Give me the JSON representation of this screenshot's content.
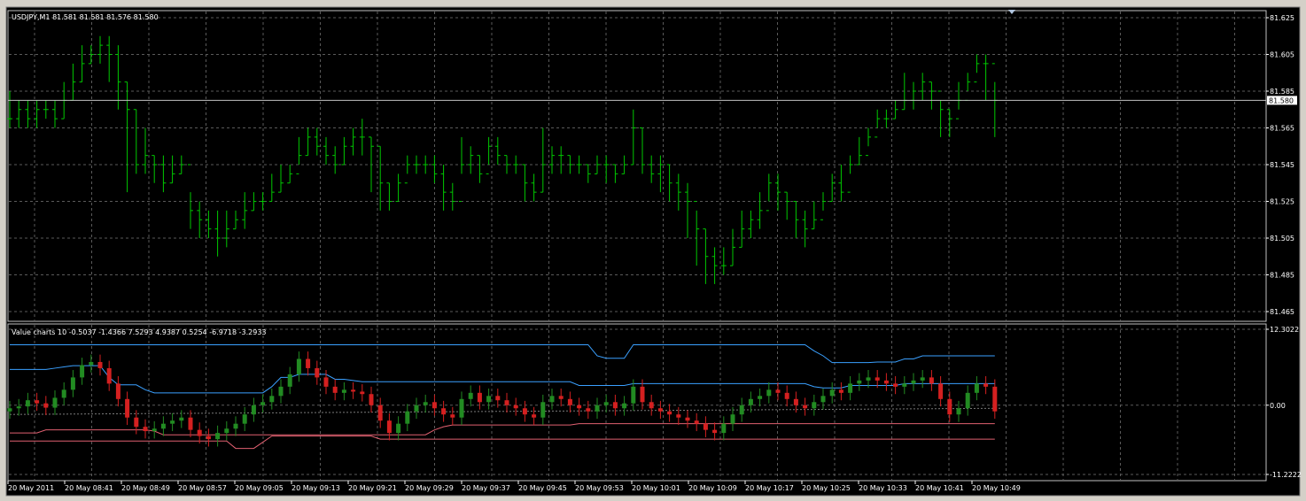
{
  "window": {
    "symbol_header": "USDJPY,M1  81.581 81.581 81.576 81.580"
  },
  "colors": {
    "background": "#000000",
    "grid": "#5a5a5a",
    "price_bars": "#00c800",
    "bull_candle": "#228b22",
    "bear_candle": "#d42020",
    "upper_band": "#3aa0ff",
    "lower_band": "#e06070",
    "axis_text": "#ffffff"
  },
  "chart_data": [
    {
      "type": "bar",
      "name": "price",
      "ohlc_style": "ohlc-bars",
      "ylim": [
        81.465,
        81.625
      ],
      "yticks": [
        "81.625",
        "81.605",
        "81.585",
        "81.565",
        "81.545",
        "81.525",
        "81.505",
        "81.485",
        "81.465"
      ],
      "current_price_label": "81.580",
      "current_price": 81.58,
      "grid": true,
      "close": [
        81.57,
        81.575,
        81.57,
        81.575,
        81.575,
        81.57,
        81.58,
        81.59,
        81.6,
        81.605,
        81.61,
        81.605,
        81.59,
        81.575,
        81.545,
        81.55,
        81.545,
        81.535,
        81.54,
        81.545,
        81.52,
        81.515,
        81.51,
        81.505,
        81.51,
        81.515,
        81.52,
        81.525,
        81.525,
        81.53,
        81.535,
        81.54,
        81.55,
        81.56,
        81.555,
        81.55,
        81.545,
        81.555,
        81.56,
        81.56,
        81.555,
        81.535,
        81.525,
        81.535,
        81.545,
        81.545,
        81.545,
        81.54,
        81.53,
        81.525,
        81.545,
        81.55,
        81.54,
        81.555,
        81.55,
        81.545,
        81.545,
        81.535,
        81.53,
        81.545,
        81.55,
        81.55,
        81.545,
        81.545,
        81.54,
        81.545,
        81.545,
        81.54,
        81.545,
        81.565,
        81.545,
        81.54,
        81.545,
        81.535,
        81.53,
        81.525,
        81.51,
        81.495,
        81.49,
        81.49,
        81.5,
        81.51,
        81.515,
        81.52,
        81.535,
        81.53,
        81.525,
        81.515,
        81.51,
        81.515,
        81.525,
        81.535,
        81.53,
        81.545,
        81.55,
        81.56,
        81.57,
        81.57,
        81.575,
        81.58,
        81.585,
        81.59,
        81.585,
        81.575,
        81.57,
        81.58,
        81.59,
        81.6,
        81.6,
        81.58
      ],
      "high": [
        81.585,
        81.58,
        81.58,
        81.58,
        81.58,
        81.58,
        81.59,
        81.6,
        81.61,
        81.61,
        81.615,
        81.615,
        81.61,
        81.59,
        81.575,
        81.565,
        81.55,
        81.55,
        81.55,
        81.55,
        81.53,
        81.525,
        81.52,
        81.52,
        81.52,
        81.52,
        81.53,
        81.53,
        81.53,
        81.54,
        81.545,
        81.545,
        81.56,
        81.565,
        81.565,
        81.56,
        81.555,
        81.56,
        81.565,
        81.57,
        81.56,
        81.555,
        81.535,
        81.54,
        81.55,
        81.55,
        81.55,
        81.55,
        81.545,
        81.535,
        81.56,
        81.555,
        81.55,
        81.56,
        81.56,
        81.55,
        81.55,
        81.545,
        81.54,
        81.565,
        81.555,
        81.555,
        81.55,
        81.55,
        81.545,
        81.55,
        81.55,
        81.545,
        81.55,
        81.575,
        81.565,
        81.55,
        81.55,
        81.545,
        81.54,
        81.535,
        81.52,
        81.51,
        81.5,
        81.5,
        81.51,
        81.52,
        81.52,
        81.53,
        81.54,
        81.54,
        81.53,
        81.525,
        81.52,
        81.525,
        81.53,
        81.54,
        81.545,
        81.55,
        81.56,
        81.565,
        81.575,
        81.575,
        81.58,
        81.595,
        81.59,
        81.595,
        81.59,
        81.58,
        81.575,
        81.59,
        81.595,
        81.605,
        81.605,
        81.59
      ],
      "low": [
        81.565,
        81.565,
        81.565,
        81.565,
        81.57,
        81.565,
        81.57,
        81.58,
        81.59,
        81.6,
        81.6,
        81.59,
        81.575,
        81.53,
        81.54,
        81.54,
        81.535,
        81.53,
        81.535,
        81.54,
        81.51,
        81.505,
        81.505,
        81.495,
        81.5,
        81.51,
        81.51,
        81.52,
        81.52,
        81.525,
        81.53,
        81.535,
        81.545,
        81.55,
        81.55,
        81.545,
        81.54,
        81.545,
        81.55,
        81.55,
        81.53,
        81.52,
        81.52,
        81.525,
        81.54,
        81.54,
        81.54,
        81.535,
        81.52,
        81.52,
        81.54,
        81.54,
        81.535,
        81.545,
        81.545,
        81.54,
        81.54,
        81.525,
        81.525,
        81.53,
        81.54,
        81.54,
        81.54,
        81.54,
        81.535,
        81.54,
        81.535,
        81.535,
        81.54,
        81.545,
        81.54,
        81.535,
        81.53,
        81.525,
        81.52,
        81.505,
        81.49,
        81.48,
        81.48,
        81.485,
        81.49,
        81.5,
        81.505,
        81.51,
        81.525,
        81.52,
        81.515,
        81.505,
        81.5,
        81.51,
        81.52,
        81.525,
        81.525,
        81.54,
        81.545,
        81.555,
        81.565,
        81.565,
        81.57,
        81.575,
        81.575,
        81.58,
        81.575,
        81.56,
        81.56,
        81.575,
        81.585,
        81.595,
        81.58,
        81.56
      ]
    },
    {
      "type": "bar",
      "name": "indicator",
      "ohlc_style": "candlestick",
      "header_text": "Value charts 10  -0.5037  -1.4366  7.5293  4.9387  0.5254  -6.9718  -3.2933",
      "ylim": [
        -11.2222,
        12.3022
      ],
      "yticks": [
        "12.3022",
        "0.00",
        "-11.2222"
      ],
      "grid": true,
      "candles": [
        -0.5,
        -0.2,
        0.8,
        0.3,
        -0.4,
        1.2,
        2.5,
        4.5,
        6.5,
        7.0,
        6.0,
        3.5,
        1.0,
        -2.0,
        -3.5,
        -4.2,
        -3.8,
        -3.0,
        -2.5,
        -2.0,
        -4.0,
        -5.0,
        -5.5,
        -4.5,
        -3.8,
        -3.0,
        -1.5,
        0.0,
        0.5,
        1.5,
        3.0,
        5.0,
        7.5,
        6.0,
        4.5,
        3.0,
        2.0,
        2.5,
        2.2,
        1.8,
        0.0,
        -2.5,
        -4.5,
        -3.0,
        -1.0,
        0.0,
        0.5,
        -0.5,
        -1.5,
        -2.0,
        1.0,
        2.0,
        0.5,
        1.5,
        0.8,
        0.0,
        -0.5,
        -1.5,
        -2.0,
        0.5,
        1.5,
        1.0,
        0.0,
        -0.5,
        -1.0,
        0.0,
        0.5,
        -0.5,
        0.3,
        3.0,
        0.5,
        -0.5,
        -1.0,
        -1.5,
        -2.0,
        -2.5,
        -3.0,
        -4.0,
        -4.5,
        -3.0,
        -1.5,
        0.0,
        1.0,
        1.5,
        2.5,
        2.0,
        1.0,
        0.0,
        -0.5,
        0.5,
        1.5,
        2.5,
        2.0,
        3.5,
        4.0,
        4.5,
        4.0,
        3.5,
        3.0,
        3.5,
        4.0,
        4.5,
        3.5,
        1.0,
        -1.5,
        -0.5,
        2.0,
        3.5,
        3.0,
        -1.0
      ],
      "upper_band": [
        9.8,
        9.8,
        9.8,
        9.8,
        9.8,
        9.8,
        9.8,
        9.8,
        9.8,
        9.8,
        9.8,
        9.8,
        9.8,
        9.8,
        9.8,
        9.8,
        9.8,
        9.8,
        9.8,
        9.8,
        9.8,
        9.8,
        9.8,
        9.8,
        9.8,
        9.8,
        9.8,
        9.8,
        9.8,
        9.8,
        9.8,
        9.8,
        9.8,
        9.8,
        9.8,
        9.8,
        9.8,
        9.8,
        9.8,
        9.8,
        9.8,
        9.8,
        9.8,
        9.8,
        9.8,
        9.8,
        9.8,
        9.8,
        9.8,
        9.8,
        9.8,
        9.8,
        9.8,
        9.8,
        9.8,
        9.8,
        9.8,
        9.8,
        9.8,
        9.8,
        9.8,
        9.8,
        9.8,
        9.8,
        9.8,
        8.0,
        7.6,
        7.6,
        7.6,
        9.8,
        9.8,
        9.8,
        9.8,
        9.8,
        9.8,
        9.8,
        9.8,
        9.8,
        9.8,
        9.8,
        9.8,
        9.8,
        9.8,
        9.8,
        9.8,
        9.8,
        9.8,
        9.8,
        9.8,
        8.8,
        8.0,
        6.9,
        6.9,
        6.9,
        6.9,
        6.9,
        7.0,
        7.0,
        7.0,
        7.5,
        7.5,
        8.0,
        8.0,
        8.0,
        8.0,
        8.0,
        8.0,
        8.0,
        8.0,
        8.0
      ],
      "upper_inner": [
        5.8,
        5.8,
        5.8,
        5.8,
        5.8,
        6.0,
        6.2,
        6.4,
        6.4,
        6.4,
        6.4,
        4.5,
        3.3,
        3.3,
        3.3,
        2.5,
        2.0,
        2.0,
        2.0,
        2.0,
        2.0,
        2.0,
        2.0,
        2.0,
        2.0,
        2.0,
        2.0,
        2.0,
        2.0,
        3.0,
        4.5,
        4.5,
        5.0,
        5.0,
        5.0,
        5.0,
        4.2,
        4.2,
        4.0,
        3.8,
        3.8,
        3.8,
        3.8,
        3.8,
        3.8,
        3.8,
        3.8,
        3.8,
        3.8,
        3.8,
        3.8,
        3.8,
        3.8,
        3.8,
        3.8,
        3.8,
        3.8,
        3.8,
        3.8,
        3.8,
        3.8,
        3.8,
        3.8,
        3.2,
        3.2,
        3.2,
        3.2,
        3.2,
        3.2,
        3.5,
        3.5,
        3.5,
        3.5,
        3.5,
        3.5,
        3.5,
        3.5,
        3.5,
        3.5,
        3.5,
        3.5,
        3.5,
        3.5,
        3.5,
        3.5,
        3.5,
        3.5,
        3.5,
        3.5,
        3.0,
        2.8,
        2.8,
        2.8,
        3.2,
        3.2,
        3.2,
        3.2,
        3.2,
        3.2,
        3.5,
        3.5,
        3.5,
        3.5,
        3.5,
        3.5,
        3.5,
        3.5,
        3.5,
        3.5,
        3.5
      ],
      "lower_inner": [
        -4.5,
        -4.5,
        -4.5,
        -4.5,
        -4.0,
        -4.0,
        -4.0,
        -4.0,
        -4.0,
        -4.0,
        -4.0,
        -4.0,
        -4.0,
        -4.0,
        -4.0,
        -4.0,
        -4.2,
        -4.8,
        -4.8,
        -4.8,
        -4.8,
        -4.8,
        -4.8,
        -4.8,
        -4.8,
        -4.8,
        -4.8,
        -4.8,
        -4.8,
        -4.8,
        -4.8,
        -4.8,
        -4.8,
        -4.8,
        -4.8,
        -4.8,
        -4.8,
        -4.8,
        -4.8,
        -4.8,
        -4.8,
        -4.8,
        -4.8,
        -4.8,
        -4.8,
        -4.8,
        -4.8,
        -4.0,
        -3.5,
        -3.2,
        -3.2,
        -3.2,
        -3.2,
        -3.2,
        -3.2,
        -3.2,
        -3.2,
        -3.2,
        -3.2,
        -3.2,
        -3.2,
        -3.2,
        -3.2,
        -3.0,
        -3.0,
        -3.0,
        -3.0,
        -3.0,
        -3.0,
        -3.0,
        -3.0,
        -3.0,
        -3.0,
        -3.0,
        -3.0,
        -3.0,
        -3.0,
        -3.0,
        -3.0,
        -3.0,
        -3.0,
        -3.0,
        -3.0,
        -3.0,
        -3.0,
        -3.0,
        -3.0,
        -3.0,
        -3.0,
        -3.0,
        -3.0,
        -3.0,
        -3.0,
        -3.0,
        -3.0,
        -3.0,
        -3.0,
        -3.0,
        -3.0,
        -3.0,
        -3.0,
        -3.0,
        -3.0,
        -3.0,
        -3.0,
        -3.0,
        -3.0,
        -3.0,
        -3.0,
        -3.0
      ],
      "lower_band": [
        -5.8,
        -5.8,
        -5.8,
        -5.8,
        -5.8,
        -5.8,
        -5.8,
        -5.8,
        -5.8,
        -5.8,
        -5.8,
        -5.8,
        -5.8,
        -5.8,
        -5.8,
        -5.8,
        -5.8,
        -5.8,
        -5.8,
        -5.8,
        -5.8,
        -5.8,
        -5.8,
        -5.8,
        -5.8,
        -7.0,
        -7.0,
        -7.0,
        -6.0,
        -5.0,
        -5.0,
        -5.0,
        -5.0,
        -5.0,
        -5.0,
        -5.0,
        -5.0,
        -5.0,
        -5.0,
        -5.0,
        -5.0,
        -5.5,
        -5.5,
        -5.5,
        -5.5,
        -5.5,
        -5.5,
        -5.5,
        -5.5,
        -5.5,
        -5.5,
        -5.5,
        -5.5,
        -5.5,
        -5.5,
        -5.5,
        -5.5,
        -5.5,
        -5.5,
        -5.5,
        -5.5,
        -5.5,
        -5.5,
        -5.5,
        -5.5,
        -5.5,
        -5.5,
        -5.5,
        -5.5,
        -5.5,
        -5.5,
        -5.5,
        -5.5,
        -5.5,
        -5.5,
        -5.5,
        -5.5,
        -5.5,
        -5.5,
        -5.5,
        -5.5,
        -5.5,
        -5.5,
        -5.5,
        -5.5,
        -5.5,
        -5.5,
        -5.5,
        -5.5,
        -5.5,
        -5.5,
        -5.5,
        -5.5,
        -5.5,
        -5.5,
        -5.5,
        -5.5,
        -5.5,
        -5.5,
        -5.5,
        -5.5,
        -5.5,
        -5.5,
        -5.5,
        -5.5,
        -5.5,
        -5.5,
        -5.5,
        -5.5,
        -5.5
      ]
    }
  ],
  "time_axis": {
    "labels": [
      "20 May 2011",
      "20 May 08:41",
      "20 May 08:49",
      "20 May 08:57",
      "20 May 09:05",
      "20 May 09:13",
      "20 May 09:21",
      "20 May 09:29",
      "20 May 09:37",
      "20 May 09:45",
      "20 May 09:53",
      "20 May 10:01",
      "20 May 10:09",
      "20 May 10:17",
      "20 May 10:25",
      "20 May 10:33",
      "20 May 10:41",
      "20 May 10:49"
    ]
  }
}
